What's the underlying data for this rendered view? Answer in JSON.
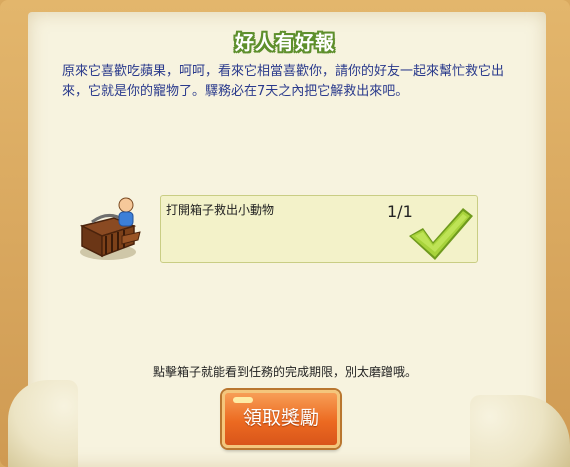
{
  "dialog": {
    "title": "好人有好報",
    "description": "原來它喜歡吃蘋果，呵呵，看來它相當喜歡你，請你的好友一起來幫忙救它出來，它就是你的寵物了。驛務必在7天之內把它解救出來吧。",
    "task": {
      "label": "打開箱子救出小動物",
      "progress": "1/1",
      "completed": true,
      "icon": "cage-box-icon",
      "status_icon": "green-checkmark-icon"
    },
    "hint": "點擊箱子就能看到任務的完成期限，別太磨蹭哦。",
    "claim_button": "領取獎勵"
  },
  "colors": {
    "frame": "#d9a95f",
    "paper": "#f7f3df",
    "title_outline": "#5e8f2c",
    "description_text": "#2a3a8c",
    "task_box": "#f3f2c9",
    "button": "#ec6a21"
  }
}
